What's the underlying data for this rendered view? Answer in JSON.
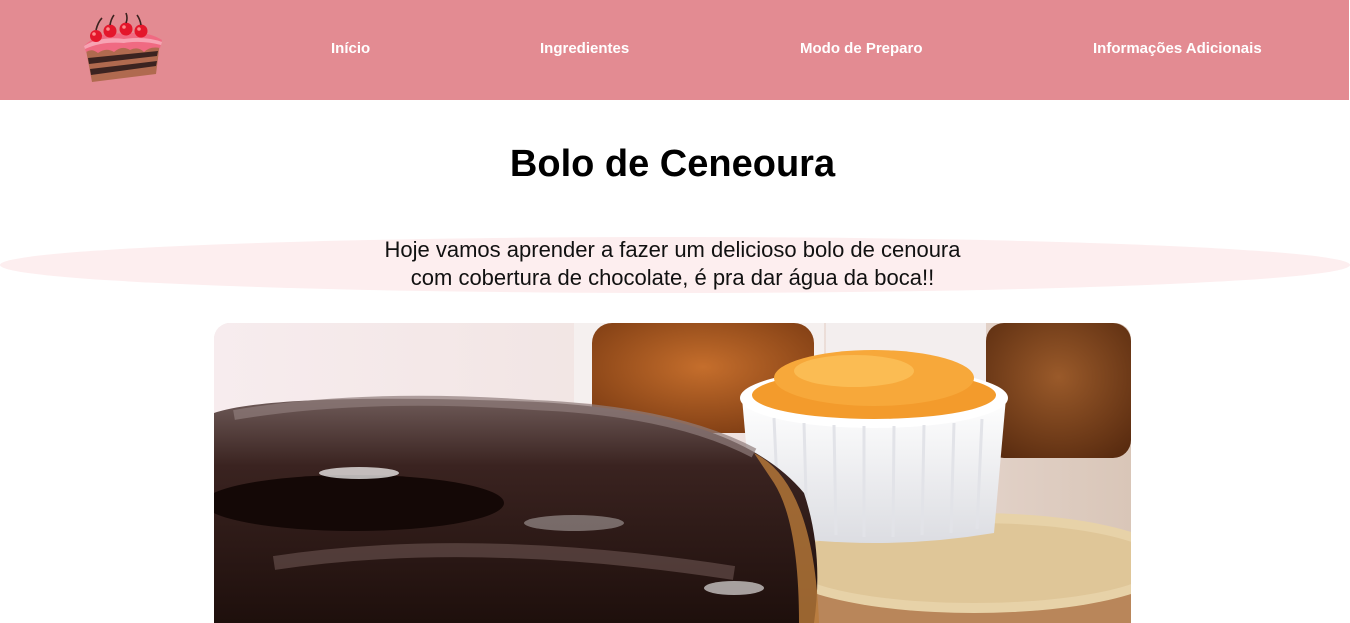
{
  "nav": {
    "logo": "cake-logo",
    "items": [
      "Início",
      "Ingredientes",
      "Modo de Preparo",
      "Informações Adicionais"
    ]
  },
  "main": {
    "title": "Bolo de Ceneoura",
    "intro_line1": "Hoje vamos aprender a fazer um delicioso bolo de cenoura",
    "intro_line2": "com cobertura de chocolate, é pra dar água da boca!!"
  },
  "colors": {
    "navbar": "#e38b92",
    "intro_band": "#fdeeef",
    "text": "#000000"
  },
  "image": {
    "subject": "carrot-cake-with-chocolate-frosting-photo"
  }
}
